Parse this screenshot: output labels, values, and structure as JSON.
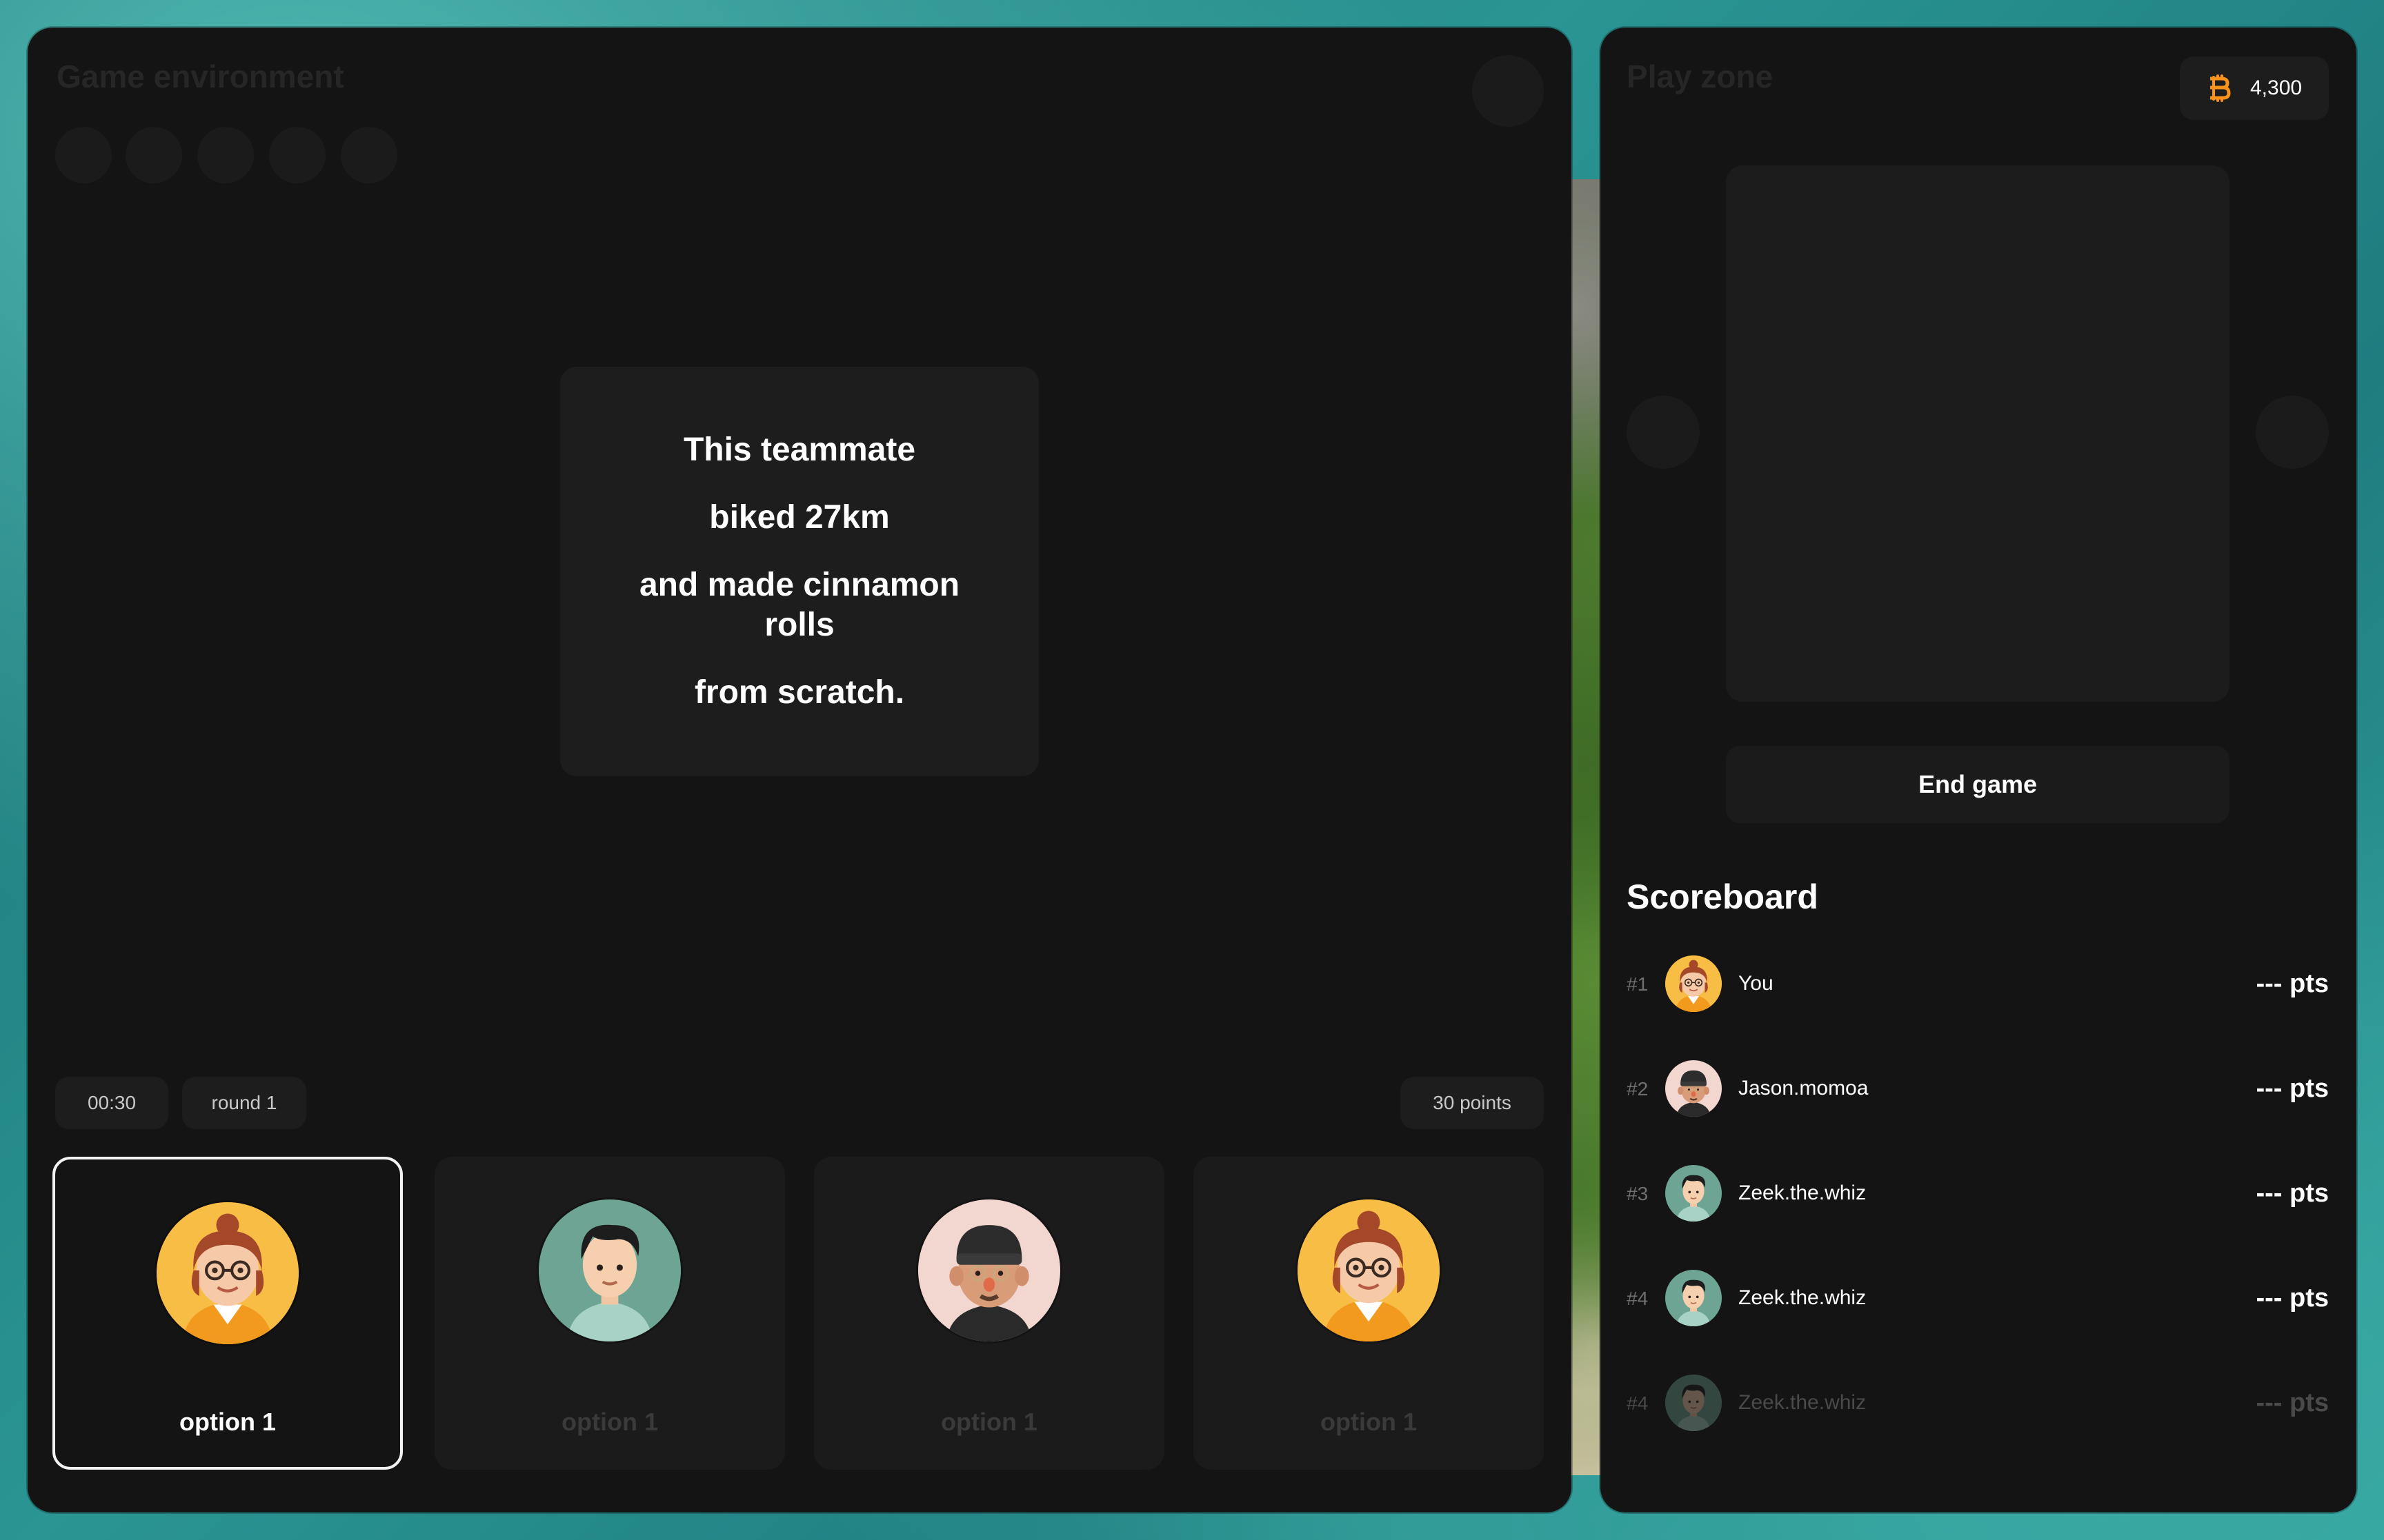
{
  "game": {
    "title": "Game environment",
    "prompt_lines": [
      "This teammate",
      "biked 27km",
      "and made cinnamon rolls",
      "from scratch."
    ],
    "timer": "00:30",
    "round": "round 1",
    "points": "30 points",
    "options": [
      {
        "label": "option 1",
        "avatar": "woman-glasses-avatar",
        "selected": true
      },
      {
        "label": "option 1",
        "avatar": "man-teal-avatar",
        "selected": false
      },
      {
        "label": "option 1",
        "avatar": "man-beanie-avatar",
        "selected": false
      },
      {
        "label": "option 1",
        "avatar": "woman-glasses-avatar",
        "selected": false
      }
    ]
  },
  "play": {
    "title": "Play zone",
    "coins": "4,300",
    "coin_icon": "bitcoin-icon",
    "end_button": "End game"
  },
  "scoreboard": {
    "title": "Scoreboard",
    "rows": [
      {
        "rank": "#1",
        "name": "You",
        "pts": "--- pts",
        "avatar": "woman-glasses-avatar"
      },
      {
        "rank": "#2",
        "name": "Jason.momoa",
        "pts": "--- pts",
        "avatar": "man-beanie-avatar"
      },
      {
        "rank": "#3",
        "name": "Zeek.the.whiz",
        "pts": "--- pts",
        "avatar": "man-teal-avatar"
      },
      {
        "rank": "#4",
        "name": "Zeek.the.whiz",
        "pts": "--- pts",
        "avatar": "man-teal-avatar"
      },
      {
        "rank": "#4",
        "name": "Zeek.the.whiz",
        "pts": "--- pts",
        "avatar": "man-teal-avatar"
      }
    ]
  },
  "colors": {
    "panel": "#141414",
    "card": "#1d1d1d",
    "accent_coin": "#f7931a",
    "background": "#2a9593"
  }
}
